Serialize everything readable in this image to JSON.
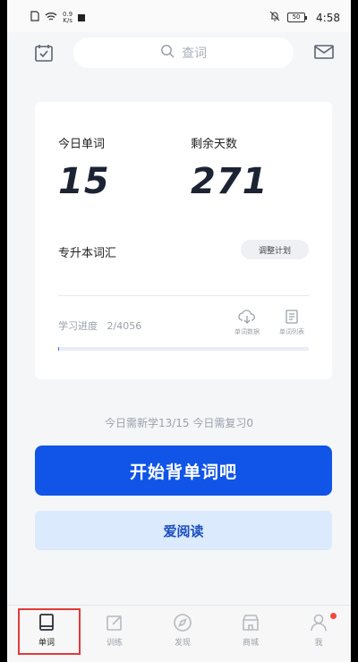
{
  "status_bar": {
    "net_speed_value": "0.9",
    "net_speed_unit": "K/s",
    "battery": "50",
    "time": "4:58"
  },
  "header": {
    "search_placeholder": "查词",
    "left_icon": "calendar-check-icon",
    "right_icon": "mail-icon"
  },
  "stats": {
    "today_words_label": "今日单词",
    "today_words_value": "15",
    "remaining_days_label": "剩余天数",
    "remaining_days_value": "271",
    "vocab_name": "专升本词汇",
    "adjust_plan_label": "调整计划",
    "progress_label": "学习进度",
    "progress_value": "2/4056",
    "progress_fraction": 0.0005,
    "word_data_label": "单词数据",
    "word_list_label": "单词列表"
  },
  "summary": {
    "text": "今日需新学13/15  今日需复习0"
  },
  "buttons": {
    "start_label": "开始背单词吧",
    "read_label": "爱阅读"
  },
  "bottom_nav": [
    {
      "label": "单词",
      "icon": "book-icon",
      "active": true
    },
    {
      "label": "训练",
      "icon": "edit-icon",
      "active": false
    },
    {
      "label": "发现",
      "icon": "compass-icon",
      "active": false
    },
    {
      "label": "商城",
      "icon": "shop-icon",
      "active": false
    },
    {
      "label": "我",
      "icon": "person-icon",
      "active": false
    }
  ],
  "colors": {
    "primary": "#1054e8",
    "secondary_bg": "#dceafe",
    "badge": "#f04a3a"
  }
}
